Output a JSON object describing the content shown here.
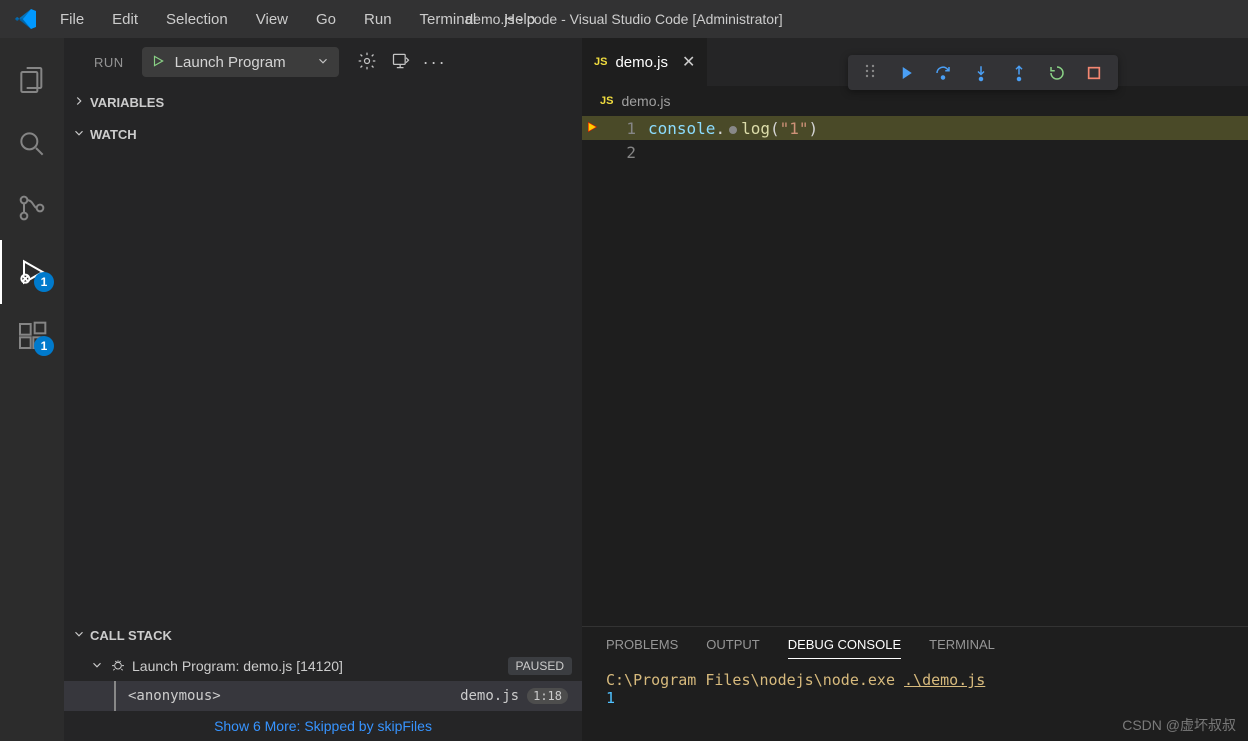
{
  "title": "demo.js - code - Visual Studio Code [Administrator]",
  "menu": [
    "File",
    "Edit",
    "Selection",
    "View",
    "Go",
    "Run",
    "Terminal",
    "Help"
  ],
  "activitybar": {
    "debug_badge": "1",
    "ext_badge": "1"
  },
  "run": {
    "label": "RUN",
    "config": "Launch Program",
    "sections": {
      "variables": "VARIABLES",
      "watch": "WATCH",
      "callstack": "CALL STACK"
    },
    "callstack": {
      "program": "Launch Program: demo.js [14120]",
      "state": "PAUSED",
      "frame": {
        "name": "<anonymous>",
        "file": "demo.js",
        "pos": "1:18"
      },
      "show_more": "Show 6 More: Skipped by skipFiles"
    }
  },
  "tab": {
    "lang": "JS",
    "name": "demo.js"
  },
  "breadcrumb": {
    "lang": "JS",
    "name": "demo.js"
  },
  "code": {
    "lines": [
      {
        "num": "1",
        "current": true,
        "tokens": {
          "obj": "console",
          "dot": ".",
          "fn": "log",
          "open": "(",
          "str": "\"1\"",
          "close": ")"
        }
      },
      {
        "num": "2",
        "current": false
      }
    ]
  },
  "panel": {
    "tabs": [
      "PROBLEMS",
      "OUTPUT",
      "DEBUG CONSOLE",
      "TERMINAL"
    ],
    "active_tab": 2,
    "output": {
      "path": "C:\\Program Files\\nodejs\\node.exe ",
      "arg": ".\\demo.js",
      "value": "1"
    }
  },
  "watermark": "CSDN @虚坏叔叔"
}
